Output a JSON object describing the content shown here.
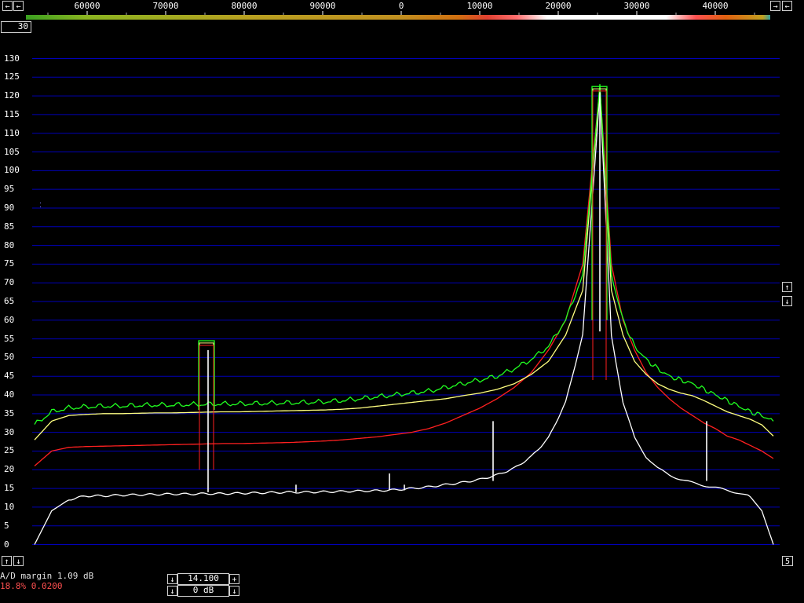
{
  "top_axis": {
    "labels": [
      "60000",
      "70000",
      "80000",
      "90000",
      "0",
      "10000",
      "20000",
      "30000",
      "40000"
    ],
    "left_arrow": "←",
    "right_arrow": "→",
    "left_arrow_icon": "arrow-left-icon",
    "right_arrow_icon": "arrow-right-icon"
  },
  "avg_box": {
    "value": "30"
  },
  "right_controls": {
    "up": "↑",
    "down": "↓",
    "up_icon": "arrow-up-icon",
    "down_icon": "arrow-down-icon",
    "value_box": "5"
  },
  "left_controls": {
    "up": "↑",
    "down": "↓",
    "up_icon": "arrow-up-icon",
    "down_icon": "arrow-down-icon"
  },
  "status": {
    "ad_margin": "A/D margin 1.09 dB",
    "load": "18.8% 0.0200"
  },
  "bottom_fields": {
    "frequency": "14.100",
    "gain": "0 dB",
    "down": "↓",
    "down_icon": "arrow-down-icon"
  },
  "colors": {
    "grid": "#0000b8",
    "white_trace": "#ffffff",
    "red_trace": "#ff2020",
    "yellow_trace": "#ffff80",
    "green_trace": "#20ff20",
    "status_red": "#ff5050"
  },
  "chart_data": {
    "type": "line",
    "title": "",
    "xlabel": "",
    "ylabel": "",
    "ylim": [
      -7,
      137
    ],
    "yticks": [
      130,
      125,
      120,
      115,
      110,
      105,
      100,
      95,
      90,
      85,
      80,
      75,
      70,
      65,
      60,
      55,
      50,
      45,
      40,
      35,
      30,
      25,
      20,
      15,
      10,
      5,
      0
    ],
    "grid": true,
    "x_positions_index": [
      0,
      1,
      2,
      3,
      4,
      5,
      6,
      7,
      8,
      9,
      10,
      11,
      12,
      13,
      14,
      15,
      16,
      17,
      18,
      19,
      20,
      21,
      22,
      23,
      24,
      25,
      26,
      27,
      28,
      29,
      30,
      31,
      32,
      33,
      34,
      35,
      36,
      37,
      38,
      39,
      40,
      41,
      42,
      43,
      44,
      45,
      46,
      47,
      48
    ],
    "series": [
      {
        "name": "",
        "color": "white",
        "values": [
          0,
          9,
          12,
          13,
          13,
          13.2,
          13.3,
          13.4,
          13.5,
          13.5,
          13.6,
          13.6,
          13.7,
          13.8,
          13.9,
          14,
          14,
          14.1,
          14.2,
          14.3,
          14.4,
          14.6,
          15,
          15.4,
          16,
          16.6,
          17.4,
          18.6,
          20.4,
          23.5,
          28.5,
          38,
          56,
          121,
          56,
          38,
          28.5,
          23.5,
          20.4,
          18.6,
          17.4,
          16.5,
          15.8,
          15.2,
          14.5,
          13.8,
          12.8,
          9,
          0
        ]
      },
      {
        "name": "",
        "color": "red",
        "values": [
          21,
          25,
          26,
          26.2,
          26.3,
          26.4,
          26.5,
          26.6,
          26.7,
          26.8,
          26.9,
          27,
          27,
          27.1,
          27.2,
          27.3,
          27.5,
          27.7,
          28,
          28.4,
          28.8,
          29.4,
          30,
          31,
          32.5,
          34.5,
          36.5,
          39,
          42,
          46,
          52,
          60,
          75,
          122.5,
          75,
          60,
          52,
          46,
          42,
          39,
          36.5,
          34.5,
          32.5,
          31,
          29,
          28,
          26.5,
          25,
          23
        ]
      },
      {
        "name": "",
        "color": "yellow",
        "values": [
          28,
          33,
          34.5,
          34.8,
          35,
          35,
          35.1,
          35.2,
          35.2,
          35.3,
          35.4,
          35.5,
          35.5,
          35.6,
          35.7,
          35.8,
          35.9,
          36,
          36.2,
          36.5,
          37,
          37.5,
          38,
          38.5,
          39,
          39.8,
          40.5,
          41.5,
          43,
          45.5,
          49,
          56,
          68,
          122.5,
          68,
          56,
          49,
          45.5,
          43,
          41.5,
          40.5,
          39.8,
          38.5,
          37,
          35.5,
          34.5,
          33.5,
          32,
          29
        ]
      },
      {
        "name": "",
        "color": "green",
        "values": [
          32,
          35.5,
          36.5,
          36.8,
          37,
          37,
          37.2,
          37.3,
          37.3,
          37.4,
          37.5,
          37.6,
          37.6,
          37.7,
          37.8,
          37.9,
          38,
          38.2,
          38.5,
          39,
          39.5,
          40,
          40.5,
          41,
          42,
          43,
          44,
          45,
          47,
          49.5,
          53,
          60,
          72,
          122.5,
          72,
          60,
          53,
          49.5,
          47,
          45,
          44,
          43,
          41.5,
          40,
          38.5,
          37,
          35.5,
          34.5,
          33
        ]
      }
    ]
  }
}
